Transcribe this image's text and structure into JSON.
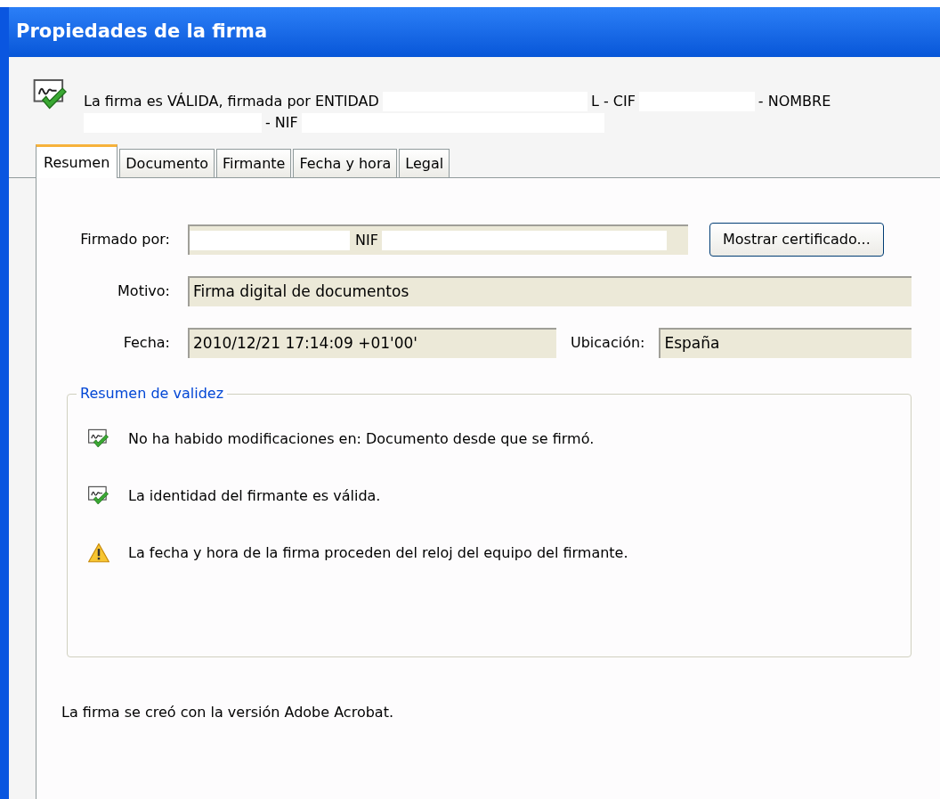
{
  "window": {
    "title": "Propiedades de la firma"
  },
  "header": {
    "line1": [
      "La firma es VÁLIDA, firmada por ENTIDAD",
      "L - CIF",
      "- NOMBRE"
    ],
    "line2": [
      "- NIF"
    ]
  },
  "tabs": [
    {
      "label": "Resumen",
      "selected": true
    },
    {
      "label": "Documento",
      "selected": false
    },
    {
      "label": "Firmante",
      "selected": false
    },
    {
      "label": "Fecha y hora",
      "selected": false
    },
    {
      "label": "Legal",
      "selected": false
    }
  ],
  "fields": {
    "signed_by": {
      "label": "Firmado por:",
      "value": "NIF"
    },
    "show_certificate": "Mostrar certificado...",
    "reason": {
      "label": "Motivo:",
      "value": "Firma digital de documentos"
    },
    "date": {
      "label": "Fecha:",
      "value": "2010/12/21 17:14:09 +01'00'"
    },
    "location": {
      "label": "Ubicación:",
      "value": "España"
    }
  },
  "validity": {
    "title": "Resumen de validez",
    "items": [
      {
        "kind": "ok",
        "text": "No ha habido modificaciones en: Documento desde que se firmó."
      },
      {
        "kind": "ok",
        "text": "La identidad del firmante es válida."
      },
      {
        "kind": "warning",
        "text": "La fecha y hora de la firma proceden del reloj del equipo del firmante."
      }
    ]
  },
  "footer": "La firma se creó con la versión Adobe Acrobat."
}
